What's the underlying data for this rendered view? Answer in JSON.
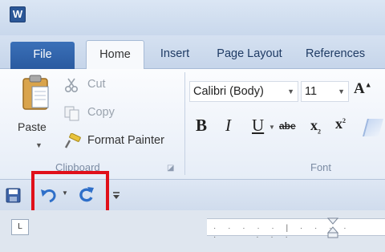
{
  "app": {
    "icon_letter": "W"
  },
  "tabs": {
    "file": "File",
    "home": "Home",
    "insert": "Insert",
    "page_layout": "Page Layout",
    "references": "References"
  },
  "clipboard": {
    "paste_label": "Paste",
    "cut_label": "Cut",
    "copy_label": "Copy",
    "format_painter_label": "Format Painter",
    "group_label": "Clipboard"
  },
  "font": {
    "font_name": "Calibri (Body)",
    "font_size": "11",
    "group_label": "Font",
    "bold": "B",
    "italic": "I",
    "underline": "U",
    "strikethrough": "abe",
    "subscript": "x",
    "superscript": "x"
  },
  "ruler": {
    "tab_selector": "L"
  },
  "colors": {
    "file_tab": "#2a5aa0",
    "highlight": "#e0101a",
    "ribbon_bg": "#e6edf7"
  },
  "icons": {
    "save": "save-icon",
    "undo": "undo-icon",
    "redo": "redo-icon",
    "customize": "customize-qat-icon"
  }
}
